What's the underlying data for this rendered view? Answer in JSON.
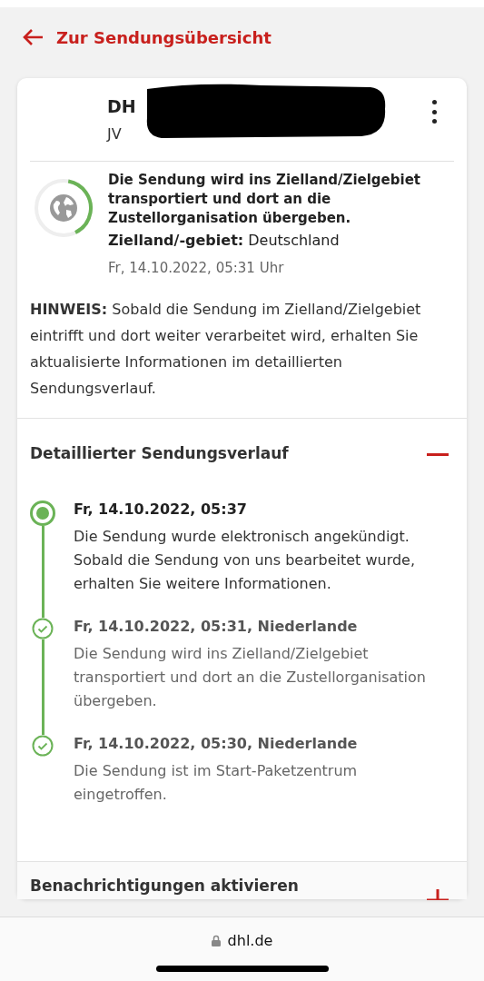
{
  "back_link": {
    "label": "Zur Sendungsübersicht"
  },
  "shipment": {
    "title": "DH",
    "number": "JV",
    "status": {
      "text": "Die Sendung wird ins Zielland/Zielgebiet transportiert und dort an die Zustellorganisation übergeben.",
      "destination_label": "Zielland/-gebiet:",
      "destination": "Deutschland",
      "time": "Fr, 14.10.2022, 05:31 Uhr",
      "level": 0.4
    },
    "note": "**HINWEIS:** Sobald die Sendung im Zielland/Zielgebiet eintrifft und dort weiter verarbeitet wird, erhalten Sie aktualisierte Informationen im detaillierten Sendungsverlauf."
  },
  "sections": [
    {
      "title": "Detaillierter Sendungsverlauf",
      "expanded": true,
      "events": [
        {
          "kind": "current",
          "time": "Fr, 14.10.2022, 05:37",
          "text": "Die Sendung wurde elektronisch angekündigt. Sobald die Sendung von uns bearbeitet wurde, erhalten Sie weitere Informationen."
        },
        {
          "kind": "done",
          "time": "Fr, 14.10.2022, 05:31, Niederlande",
          "text": "Die Sendung wird ins Zielland/Zielgebiet transportiert und dort an die Zustellorganisation übergeben."
        },
        {
          "kind": "done",
          "time": "Fr, 14.10.2022, 05:30, Niederlande",
          "text": "Die Sendung ist im Start-Paketzentrum eingetroffen."
        }
      ]
    },
    {
      "title": "Benachrichtigungen aktivieren",
      "expanded": false
    }
  ],
  "browser_bar": {
    "url": "dhl.de"
  }
}
